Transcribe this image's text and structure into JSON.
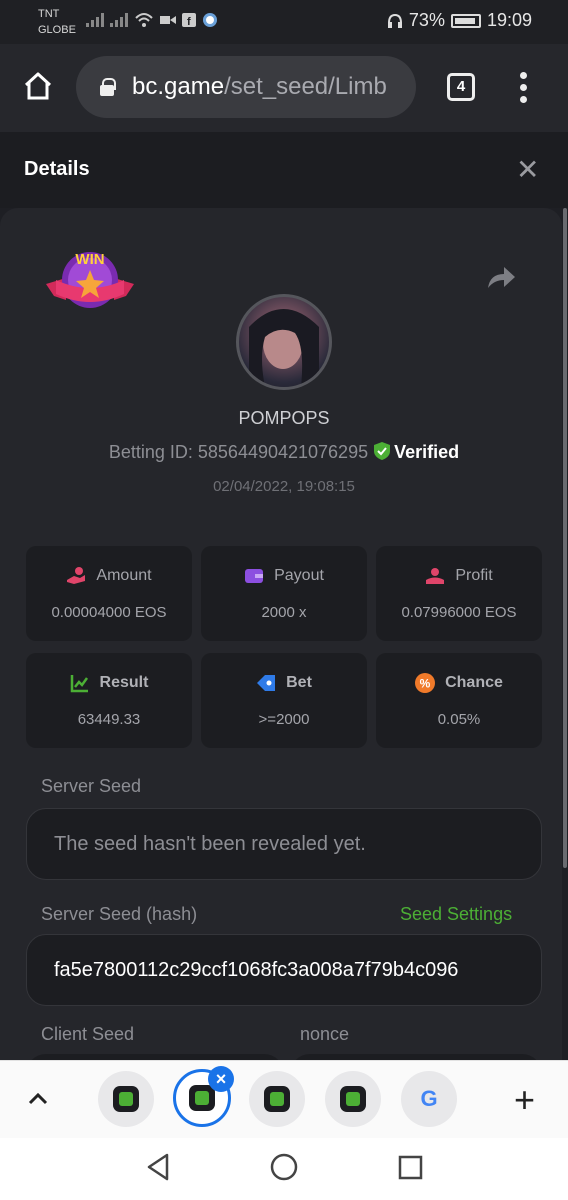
{
  "status": {
    "carrier_line1": "TNT",
    "carrier_line2": "GLOBE",
    "battery": "73%",
    "time": "19:09"
  },
  "browser": {
    "url_host": "bc.game",
    "url_path": "/set_seed/Limb",
    "tab_count": "4"
  },
  "header": {
    "title": "Details",
    "close": "✕"
  },
  "bet": {
    "username": "POMPOPS",
    "betting_id_label": "Betting ID: 58564490421076295",
    "verified": "Verified",
    "date": "02/04/2022, 19:08:15",
    "badge_text": "WIN"
  },
  "stats": {
    "amount_label": "Amount",
    "amount_value": "0.00004000 EOS",
    "payout_label": "Payout",
    "payout_value": "2000 x",
    "profit_label": "Profit",
    "profit_value": "0.07996000 EOS",
    "result_label": "Result",
    "result_value": "63449.33",
    "bet_label": "Bet",
    "bet_value": ">=2000",
    "chance_label": "Chance",
    "chance_value": "0.05%"
  },
  "seeds": {
    "server_seed_label": "Server Seed",
    "server_seed_value": "The seed hasn't been revealed yet.",
    "server_hash_label": "Server Seed (hash)",
    "seed_settings": "Seed Settings",
    "server_hash_value": "fa5e7800112c29ccf1068fc3a008a7f79b4c096",
    "client_seed_label": "Client Seed",
    "nonce_label": "nonce"
  },
  "colors": {
    "accent_green": "#4caf35",
    "tab_blue": "#1a73e8",
    "background": "#1e1f24"
  }
}
